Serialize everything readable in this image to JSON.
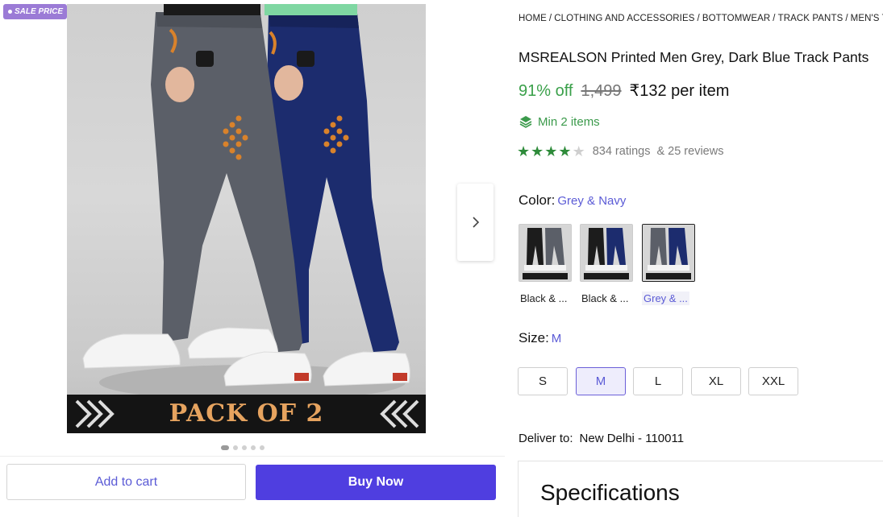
{
  "gallery": {
    "badge": "SALE PRICE",
    "banner_text": "PACK OF 2",
    "dots_total": 5,
    "dots_active_index": 0
  },
  "actions": {
    "add_to_cart": "Add to cart",
    "buy_now": "Buy Now"
  },
  "breadcrumb": [
    "HOME",
    "CLOTHING AND ACCESSORIES",
    "BOTTOMWEAR",
    "TRACK PANTS",
    "MEN'S TRAC"
  ],
  "product": {
    "title": "MSREALSON Printed Men Grey, Dark Blue Track Pants",
    "discount": "91% off",
    "mrp": "1,499",
    "price": "₹132 per item",
    "min_items": "Min 2 items",
    "rating_stars": 4,
    "ratings_count": "834 ratings",
    "reviews_count": "& 25 reviews"
  },
  "color": {
    "label": "Color:",
    "selected": "Grey & Navy",
    "options": [
      {
        "caption": "Black & ...",
        "selected": false,
        "pants": [
          "#1c1c1c",
          "#5b5f68"
        ]
      },
      {
        "caption": "Black & ...",
        "selected": false,
        "pants": [
          "#1c1c1c",
          "#1c2c6e"
        ]
      },
      {
        "caption": "Grey & ...",
        "selected": true,
        "pants": [
          "#5b5f68",
          "#1c2c6e"
        ]
      }
    ]
  },
  "size": {
    "label": "Size:",
    "selected": "M",
    "options": [
      "S",
      "M",
      "L",
      "XL",
      "XXL"
    ]
  },
  "delivery": {
    "label": "Deliver to:",
    "location": "New Delhi - 110011"
  },
  "specifications": {
    "heading": "Specifications"
  },
  "colors": {
    "accent": "#4f3ee0",
    "discount_green": "#3aa04a",
    "star_green": "#2e8b3a",
    "badge_purple": "#9b7bd6",
    "grey_pant": "#5b5f68",
    "navy_pant": "#1c2c6e",
    "print_orange": "#d9822b"
  }
}
